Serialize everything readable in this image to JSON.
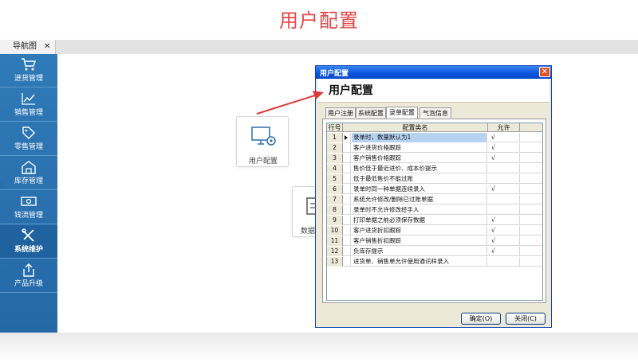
{
  "banner": {
    "title": "用户配置"
  },
  "nav_tab": {
    "label": "导航图",
    "close": "✕"
  },
  "sidebar": {
    "items": [
      {
        "label": "进货管理",
        "icon": "cart-icon"
      },
      {
        "label": "销售管理",
        "icon": "trend-chart-icon"
      },
      {
        "label": "零售管理",
        "icon": "tag-icon"
      },
      {
        "label": "库存管理",
        "icon": "warehouse-icon"
      },
      {
        "label": "钱流管理",
        "icon": "cash-icon"
      },
      {
        "label": "系统维护",
        "icon": "tools-icon",
        "active": true
      },
      {
        "label": "产品升级",
        "icon": "upload-icon"
      }
    ]
  },
  "cards": {
    "user_config": {
      "label": "用户配置",
      "icon": "monitor-gear-icon"
    },
    "data": {
      "label": "数据",
      "icon": "document-icon"
    }
  },
  "dialog": {
    "title": "用户配置",
    "heading": "用户配置",
    "close": "✕",
    "tabs": [
      {
        "label": "用户注册"
      },
      {
        "label": "系统配置"
      },
      {
        "label": "录单配置",
        "active": true
      },
      {
        "label": "气泡信息"
      }
    ],
    "grid": {
      "headers": [
        "行号",
        "配置类名",
        "允许"
      ],
      "rows": [
        {
          "num": "1",
          "name": "录单时，数量默认为1",
          "allow": "√",
          "selected": true
        },
        {
          "num": "2",
          "name": "客户进货价格跟踪",
          "allow": "√"
        },
        {
          "num": "3",
          "name": "客户销售价格跟踪",
          "allow": "√"
        },
        {
          "num": "4",
          "name": "售价低于最近进价、成本价提示",
          "allow": ""
        },
        {
          "num": "5",
          "name": "低于最低售价不能过账",
          "allow": ""
        },
        {
          "num": "6",
          "name": "录单时同一种单据连续录入",
          "allow": "√"
        },
        {
          "num": "7",
          "name": "系统允许修改/删除已过账单据",
          "allow": ""
        },
        {
          "num": "8",
          "name": "录单时不允许修改经手人",
          "allow": ""
        },
        {
          "num": "9",
          "name": "打印单据之前必须保存数据",
          "allow": "√"
        },
        {
          "num": "10",
          "name": "客户进货折扣跟踪",
          "allow": "√"
        },
        {
          "num": "11",
          "name": "客户销售折扣跟踪",
          "allow": "√"
        },
        {
          "num": "12",
          "name": "负库存提示",
          "allow": "√"
        },
        {
          "num": "13",
          "name": "进货单、销售单允许使用通讯样录入",
          "allow": ""
        }
      ]
    },
    "buttons": {
      "ok": "确定(O)",
      "close": "关闭(C)"
    }
  },
  "colors": {
    "banner_red": "#e04848",
    "sidebar_blue": "#2f7ab8",
    "arrow_red": "#e03a3a",
    "xp_title_blue": "#0a56df"
  }
}
